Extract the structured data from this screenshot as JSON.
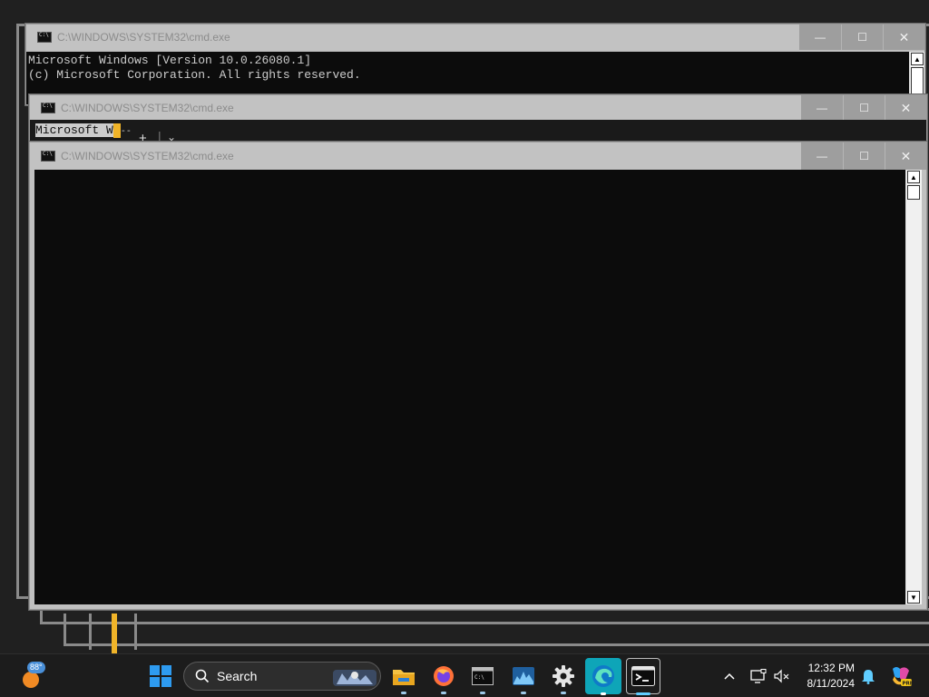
{
  "windows": {
    "back": {
      "title": "C:\\WINDOWS\\SYSTEM32\\cmd.exe",
      "lines": [
        "Microsoft Windows [Version 10.0.26080.1]",
        "(c) Microsoft Corporation. All rights reserved."
      ]
    },
    "middle": {
      "title": "C:\\WINDOWS\\SYSTEM32\\cmd.exe",
      "selected_text": "Microsoft W",
      "stray_glyphs": "--",
      "tab_new_glyph": "+",
      "tab_divider_glyph": "|",
      "tab_menu_glyph": "⌄"
    },
    "front": {
      "title": "C:\\WINDOWS\\SYSTEM32\\cmd.exe"
    },
    "caption": {
      "minimize": "—",
      "maximize": "☐",
      "close": "✕"
    }
  },
  "taskbar": {
    "weather": {
      "temperature": "88°",
      "icon": "sun-icon"
    },
    "search": {
      "label": "Search"
    },
    "apps": [
      {
        "name": "start",
        "icon": "windows-logo-icon"
      },
      {
        "name": "file-explorer",
        "icon": "folder-icon"
      },
      {
        "name": "firefox",
        "icon": "firefox-icon"
      },
      {
        "name": "command-prompt",
        "icon": "cmd-icon"
      },
      {
        "name": "task-manager",
        "icon": "performance-chart-icon"
      },
      {
        "name": "settings",
        "icon": "gear-icon"
      },
      {
        "name": "edge",
        "icon": "edge-icon"
      },
      {
        "name": "terminal",
        "icon": "terminal-icon"
      }
    ],
    "tray": {
      "chevron": "⌃",
      "time": "12:32 PM",
      "date": "8/11/2024"
    }
  },
  "colors": {
    "console_bg": "#0c0c0c",
    "console_text": "#cccccc",
    "cursor": "#f0b429",
    "taskbar_bg": "#1c1c1c",
    "accent": "#60cdff"
  }
}
